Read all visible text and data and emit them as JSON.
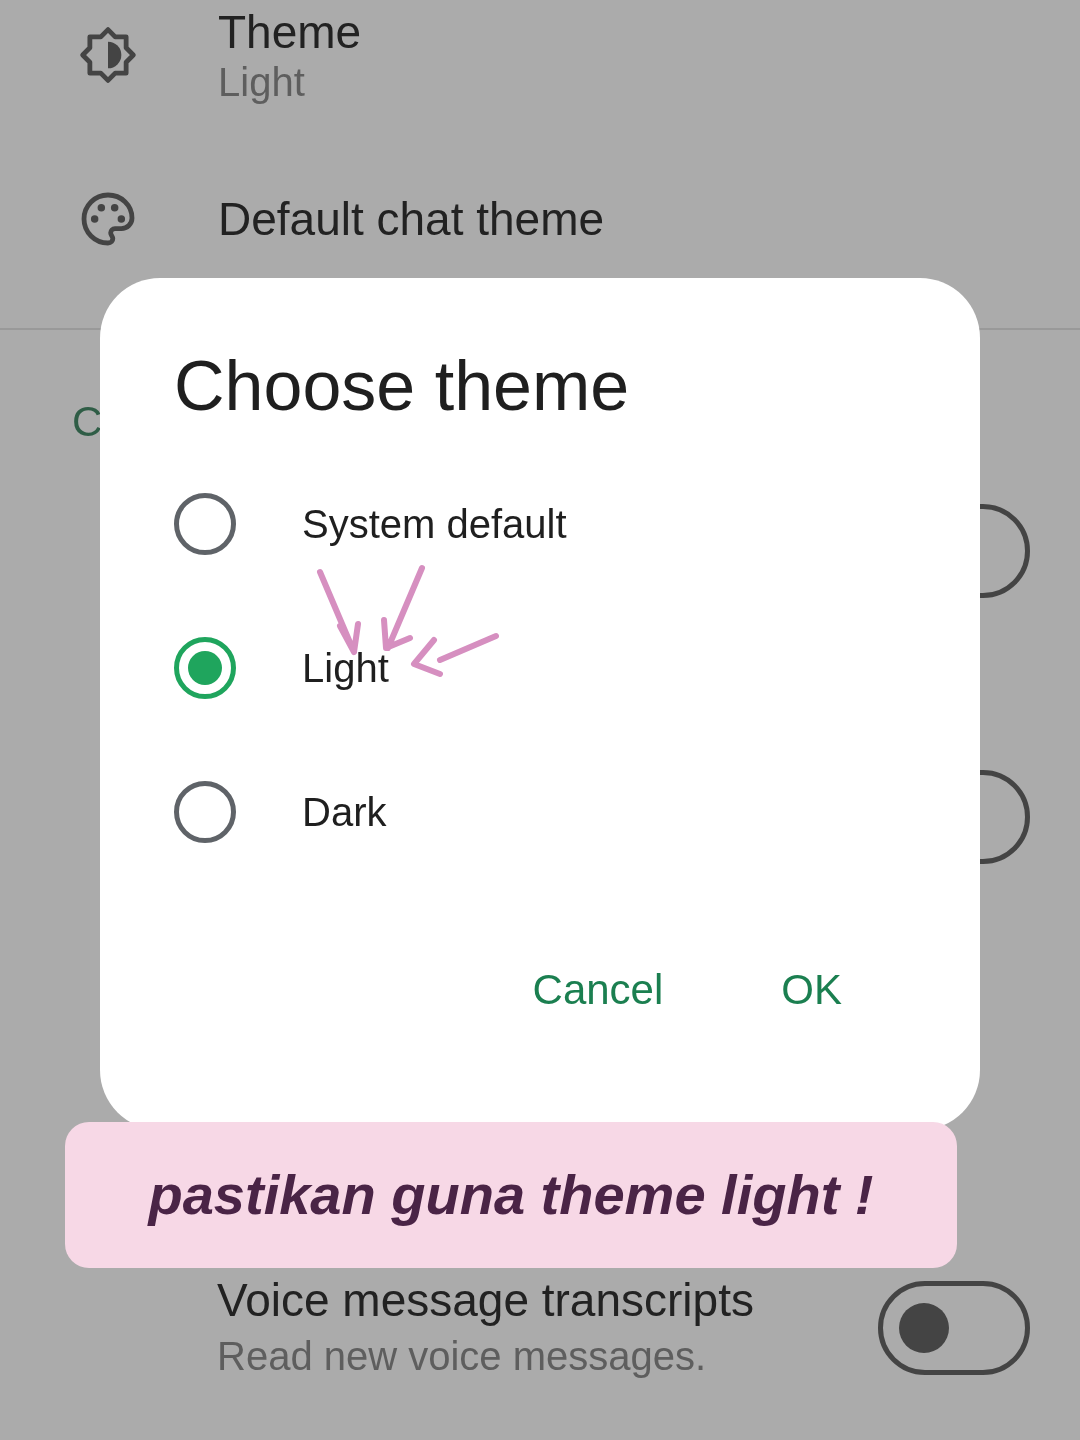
{
  "settings": [
    {
      "kind": "theme",
      "title": "Theme",
      "subtitle": "Light"
    },
    {
      "kind": "palette",
      "title": "Default chat theme"
    }
  ],
  "section_header": "C",
  "hidden_toggles": [
    {
      "on": false
    },
    {
      "on": false
    }
  ],
  "voice_transcripts": {
    "title": "Voice message transcripts",
    "subtitle": "Read new voice messages.",
    "on": false
  },
  "dialog": {
    "title": "Choose theme",
    "options": [
      {
        "label": "System default",
        "selected": false
      },
      {
        "label": "Light",
        "selected": true
      },
      {
        "label": "Dark",
        "selected": false
      }
    ],
    "buttons": [
      "Cancel",
      "OK"
    ]
  },
  "annotation": {
    "text": "pastikan guna theme light !"
  }
}
